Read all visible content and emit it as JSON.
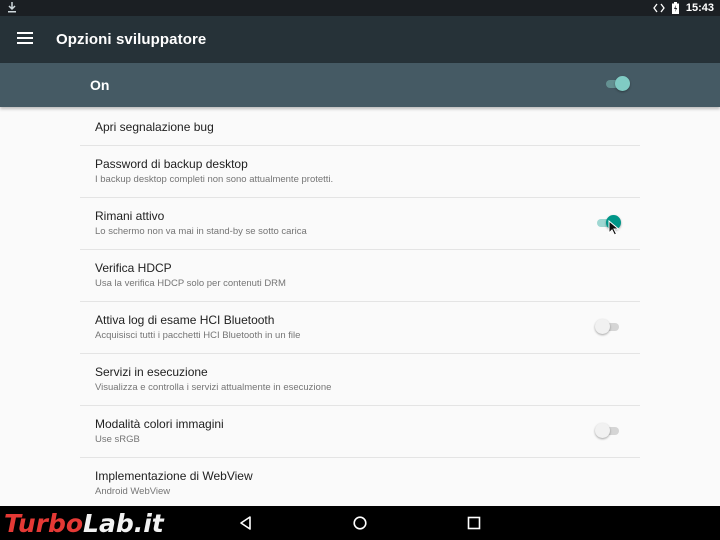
{
  "status_bar": {
    "time": "15:43",
    "icons": [
      "download-icon",
      "data-transfer-icon",
      "battery-icon"
    ]
  },
  "app_bar": {
    "title": "Opzioni sviluppatore",
    "menu_icon": "menu-icon"
  },
  "master_switch": {
    "label": "On",
    "enabled": true
  },
  "settings": [
    {
      "title": "Apri segnalazione bug",
      "subtitle": "",
      "toggle": null
    },
    {
      "title": "Password di backup desktop",
      "subtitle": "I backup desktop completi non sono attualmente protetti.",
      "toggle": null
    },
    {
      "title": "Rimani attivo",
      "subtitle": "Lo schermo non va mai in stand-by se sotto carica",
      "toggle": true
    },
    {
      "title": "Verifica HDCP",
      "subtitle": "Usa la verifica HDCP solo per contenuti DRM",
      "toggle": null
    },
    {
      "title": "Attiva log di esame HCI Bluetooth",
      "subtitle": "Acquisisci tutti i pacchetti HCI Bluetooth in un file",
      "toggle": false
    },
    {
      "title": "Servizi in esecuzione",
      "subtitle": "Visualizza e controlla i servizi attualmente in esecuzione",
      "toggle": null
    },
    {
      "title": "Modalità colori immagini",
      "subtitle": "Use sRGB",
      "toggle": false
    },
    {
      "title": "Implementazione di WebView",
      "subtitle": "Android WebView",
      "toggle": null
    }
  ],
  "nav_bar": {
    "buttons": [
      "back-icon",
      "home-icon",
      "recents-icon"
    ]
  },
  "watermark": {
    "part1": "Turbo",
    "part2": "Lab.it"
  },
  "colors": {
    "status_bar": "#1b1f23",
    "app_bar": "#263238",
    "master_bar": "#455a64",
    "accent": "#009688",
    "background": "#fafafa"
  }
}
